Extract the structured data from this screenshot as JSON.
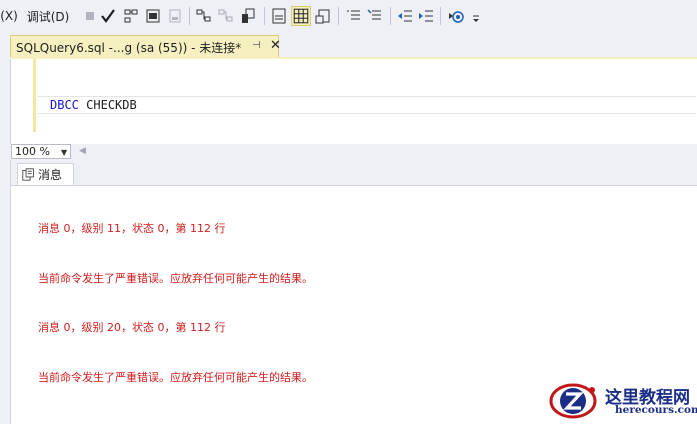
{
  "toolbar": {
    "partial_menu": "(X)",
    "debug_label": "调试(D)",
    "icons": [
      "stop-icon",
      "check-icon",
      "query-plan-icon",
      "parse-icon",
      "results-text-icon",
      "display-plan-icon",
      "live-stats-icon",
      "client-stats-icon",
      "results-to-text-icon",
      "results-to-grid-icon",
      "results-to-file-icon",
      "comment-icon",
      "uncomment-icon",
      "decrease-indent-icon",
      "increase-indent-icon",
      "specify-values-icon",
      "overflow-icon"
    ]
  },
  "tab": {
    "title": "SQLQuery6.sql -...g (sa (55)) - 未连接*",
    "pin_glyph": "⊣",
    "close_glyph": "✕"
  },
  "editor": {
    "keyword": "DBCC",
    "text": "CHECKDB"
  },
  "zoom": {
    "value": "100 %"
  },
  "results": {
    "messages_tab": "消息",
    "messages": [
      "消息 0，级别 11，状态 0，第 112 行",
      "当前命令发生了严重错误。应放弃任何可能产生的结果。",
      "消息 0，级别 20，状态 0，第 112 行",
      "当前命令发生了严重错误。应放弃任何可能产生的结果。"
    ]
  },
  "watermark": {
    "main": "这里教程网",
    "sub": "herecours.com"
  },
  "colors": {
    "keyword": "#1818c8",
    "error_text": "#d01e1e",
    "tab_active": "#f6f0c0",
    "chrome": "#eef0f6"
  }
}
